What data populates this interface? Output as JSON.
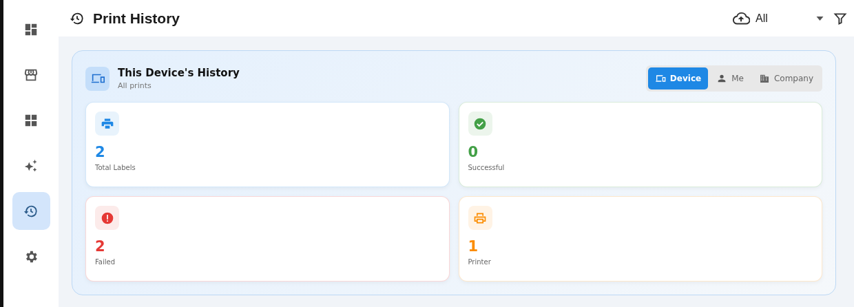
{
  "sidebar": {
    "items": [
      {
        "kind": "dashboard",
        "selected": false
      },
      {
        "kind": "store",
        "selected": false
      },
      {
        "kind": "grid",
        "selected": false
      },
      {
        "kind": "sparkle",
        "selected": false
      },
      {
        "kind": "history",
        "selected": true
      },
      {
        "kind": "settings",
        "selected": false
      }
    ]
  },
  "header": {
    "title": "Print History",
    "source_filter": {
      "value": "All"
    }
  },
  "panel": {
    "title": "This Device's History",
    "subtitle": "All prints",
    "scope_tabs": [
      {
        "label": "Device",
        "kind": "device",
        "selected": true
      },
      {
        "label": "Me",
        "kind": "person",
        "selected": false
      },
      {
        "label": "Company",
        "kind": "building",
        "selected": false
      }
    ],
    "stats": [
      {
        "value": "2",
        "label": "Total Labels",
        "kind": "printer",
        "color": "#1e88e5"
      },
      {
        "value": "0",
        "label": "Successful",
        "kind": "check",
        "color": "#43a047"
      },
      {
        "value": "2",
        "label": "Failed",
        "kind": "error",
        "color": "#e53935"
      },
      {
        "value": "1",
        "label": "Printer",
        "kind": "printer-outline",
        "color": "#fb8c00"
      }
    ]
  }
}
